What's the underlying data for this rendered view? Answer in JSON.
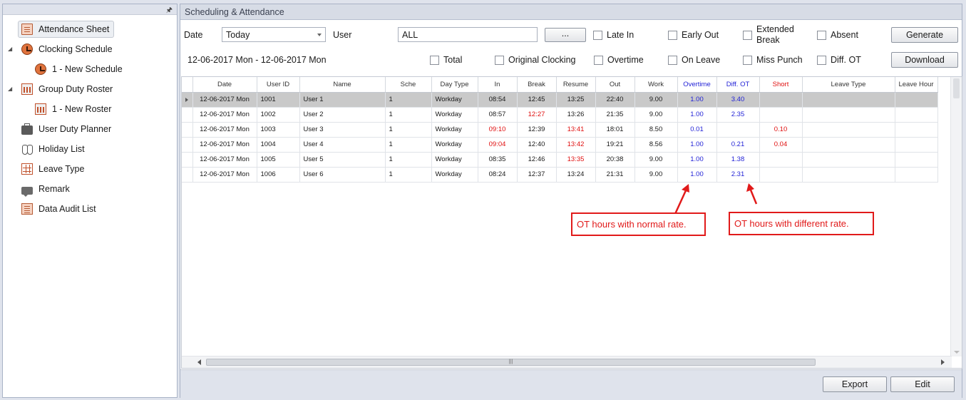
{
  "sidebar": {
    "items": [
      {
        "label": "Attendance Sheet",
        "icon": "sheet-icon"
      },
      {
        "label": "Clocking Schedule",
        "icon": "clock-icon"
      },
      {
        "label": "1 - New Schedule",
        "icon": "clock-icon"
      },
      {
        "label": "Group Duty Roster",
        "icon": "roster-icon"
      },
      {
        "label": "1 - New Roster",
        "icon": "roster-icon"
      },
      {
        "label": "User Duty Planner",
        "icon": "briefcase-icon"
      },
      {
        "label": "Holiday List",
        "icon": "slippers-icon"
      },
      {
        "label": "Leave Type",
        "icon": "grid-icon"
      },
      {
        "label": "Remark",
        "icon": "comment-icon"
      },
      {
        "label": "Data Audit List",
        "icon": "list-icon"
      }
    ]
  },
  "main": {
    "title": "Scheduling & Attendance",
    "date_label": "Date",
    "date_value": "Today",
    "user_label": "User",
    "user_value": "ALL",
    "browse_label": "...",
    "date_range": "12-06-2017 Mon - 12-06-2017 Mon",
    "generate_label": "Generate",
    "download_label": "Download",
    "export_label": "Export",
    "edit_label": "Edit",
    "filters": {
      "late_in": "Late In",
      "early_out": "Early Out",
      "extended_break_1": "Extended",
      "extended_break_2": "Break",
      "absent": "Absent",
      "total": "Total",
      "original_clocking": "Original Clocking",
      "overtime": "Overtime",
      "on_leave": "On Leave",
      "miss_punch": "Miss Punch",
      "diff_ot": "Diff. OT"
    }
  },
  "grid": {
    "columns": [
      "Date",
      "User ID",
      "Name",
      "Sche",
      "Day Type",
      "In",
      "Break",
      "Resume",
      "Out",
      "Work",
      "Overtime",
      "Diff. OT",
      "Short",
      "Leave Type",
      "Leave Hour"
    ],
    "rows": [
      {
        "date": "12-06-2017  Mon",
        "user_id": "1001",
        "name": "User 1",
        "sche": "1",
        "day_type": "Workday",
        "in": "08:54",
        "break": "12:45",
        "resume": "13:25",
        "out": "22:40",
        "work": "9.00",
        "overtime": "1.00",
        "diff_ot": "3.40",
        "short": "",
        "leave_type": "",
        "leave_hour": ""
      },
      {
        "date": "12-06-2017  Mon",
        "user_id": "1002",
        "name": "User 2",
        "sche": "1",
        "day_type": "Workday",
        "in": "08:57",
        "break": "12:27",
        "resume": "13:26",
        "out": "21:35",
        "work": "9.00",
        "overtime": "1.00",
        "diff_ot": "2.35",
        "short": "",
        "leave_type": "",
        "leave_hour": ""
      },
      {
        "date": "12-06-2017  Mon",
        "user_id": "1003",
        "name": "User 3",
        "sche": "1",
        "day_type": "Workday",
        "in": "09:10",
        "break": "12:39",
        "resume": "13:41",
        "out": "18:01",
        "work": "8.50",
        "overtime": "0.01",
        "diff_ot": "",
        "short": "0.10",
        "leave_type": "",
        "leave_hour": ""
      },
      {
        "date": "12-06-2017  Mon",
        "user_id": "1004",
        "name": "User 4",
        "sche": "1",
        "day_type": "Workday",
        "in": "09:04",
        "break": "12:40",
        "resume": "13:42",
        "out": "19:21",
        "work": "8.56",
        "overtime": "1.00",
        "diff_ot": "0.21",
        "short": "0.04",
        "leave_type": "",
        "leave_hour": ""
      },
      {
        "date": "12-06-2017  Mon",
        "user_id": "1005",
        "name": "User 5",
        "sche": "1",
        "day_type": "Workday",
        "in": "08:35",
        "break": "12:46",
        "resume": "13:35",
        "out": "20:38",
        "work": "9.00",
        "overtime": "1.00",
        "diff_ot": "1.38",
        "short": "",
        "leave_type": "",
        "leave_hour": ""
      },
      {
        "date": "12-06-2017  Mon",
        "user_id": "1006",
        "name": "User 6",
        "sche": "1",
        "day_type": "Workday",
        "in": "08:24",
        "break": "12:37",
        "resume": "13:24",
        "out": "21:31",
        "work": "9.00",
        "overtime": "1.00",
        "diff_ot": "2.31",
        "short": "",
        "leave_type": "",
        "leave_hour": ""
      }
    ],
    "red_cells": [
      [
        "1",
        "break"
      ],
      [
        "2",
        "in"
      ],
      [
        "2",
        "resume"
      ],
      [
        "3",
        "in"
      ],
      [
        "3",
        "resume"
      ],
      [
        "4",
        "resume"
      ]
    ]
  },
  "annotations": {
    "normal_rate": "OT hours with normal rate.",
    "different_rate": "OT hours with different rate."
  },
  "colors": {
    "accent_blue": "#1f1fd6",
    "alert_red": "#e01010",
    "callout_red": "#e11a1a"
  }
}
